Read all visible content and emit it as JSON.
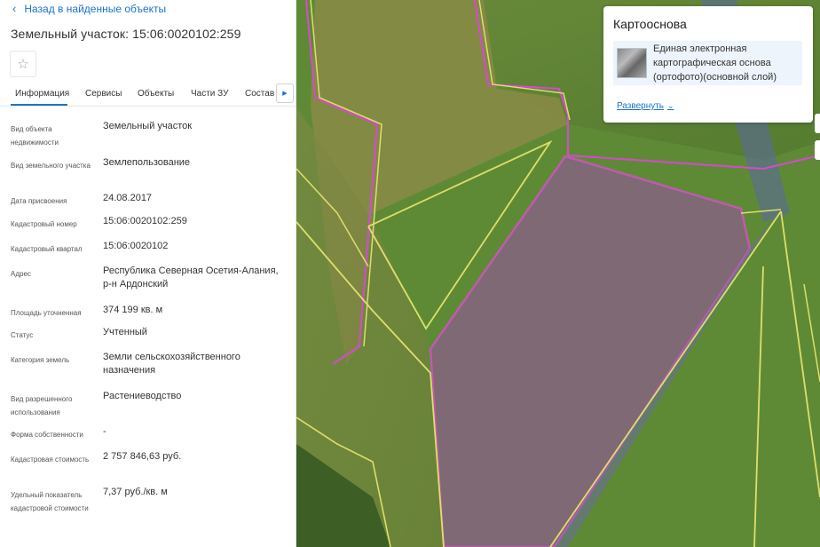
{
  "back_label": "Назад в найденные объекты",
  "title": "Земельный участок: 15:06:0020102:259",
  "tabs": [
    "Информация",
    "Сервисы",
    "Объекты",
    "Части ЗУ",
    "Состав"
  ],
  "fields": [
    {
      "label": "Вид объекта недвижимости",
      "value": "Земельный участок"
    },
    {
      "label": "Вид земельного участка",
      "value": "Землепользование"
    },
    {
      "label": "Дата присвоения",
      "value": "24.08.2017"
    },
    {
      "label": "Кадастровый номер",
      "value": "15:06:0020102:259"
    },
    {
      "label": "Кадастровый квартал",
      "value": "15:06:0020102"
    },
    {
      "label": "Адрес",
      "value": "Республика Северная Осетия-Алания, р-н Ардонский"
    },
    {
      "label": "Площадь уточненная",
      "value": "374 199 кв. м"
    },
    {
      "label": "Статус",
      "value": "Учтенный"
    },
    {
      "label": "Категория земель",
      "value": "Земли сельскохозяйственного назначения"
    },
    {
      "label": "Вид разрешенного использования",
      "value": "Растениеводство"
    },
    {
      "label": "Форма собственности",
      "value": "-"
    },
    {
      "label": "Кадастровая стоимость",
      "value": "2 757 846,63 руб."
    },
    {
      "label": "Удельный показатель кадастровой стоимости",
      "value": "7,37 руб./кв. м"
    }
  ],
  "layers": {
    "title": "Картооснова",
    "item": "Единая электронная картографическая основа (ортофото)(основной слой)",
    "expand": "Развернуть"
  }
}
